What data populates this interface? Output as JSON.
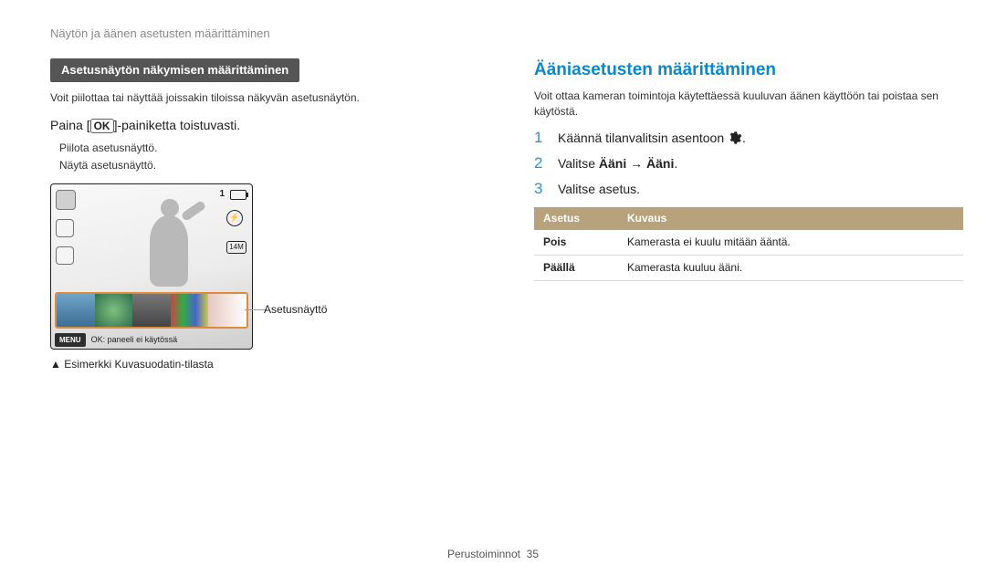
{
  "header": "Näytön ja äänen asetusten määrittäminen",
  "left": {
    "subbar": "Asetusnäytön näkymisen määrittäminen",
    "desc": "Voit piilottaa tai näyttää joissakin tiloissa näkyvän asetusnäytön.",
    "press_prefix": "Paina [",
    "ok_label": "OK",
    "press_suffix": "]-painiketta toistuvasti.",
    "line1": "Piilota asetusnäyttö.",
    "line2": "Näytä asetusnäyttö.",
    "callout": "Asetusnäyttö",
    "caption": "▲ Esimerkki Kuvasuodatin-tilasta",
    "osd": {
      "count": "1",
      "menu": "MENU",
      "bottom": "OK: paneeli ei käytössä"
    }
  },
  "right": {
    "title": "Ääniasetusten määrittäminen",
    "desc": "Voit ottaa kameran toimintoja käytettäessä kuuluvan äänen käyttöön tai poistaa sen käytöstä.",
    "steps": [
      {
        "n": "1",
        "prefix": "Käännä tilanvalitsin asentoon ",
        "suffix": "."
      },
      {
        "n": "2",
        "prefix": "Valitse ",
        "bold1": "Ääni",
        "arrow": " → ",
        "bold2": "Ääni",
        "suffix": "."
      },
      {
        "n": "3",
        "text": "Valitse asetus."
      }
    ],
    "table": {
      "h1": "Asetus",
      "h2": "Kuvaus",
      "rows": [
        {
          "k": "Pois",
          "v": "Kamerasta ei kuulu mitään ääntä."
        },
        {
          "k": "Päällä",
          "v": "Kamerasta kuuluu ääni."
        }
      ]
    }
  },
  "footer": {
    "section": "Perustoiminnot",
    "page": "35"
  }
}
